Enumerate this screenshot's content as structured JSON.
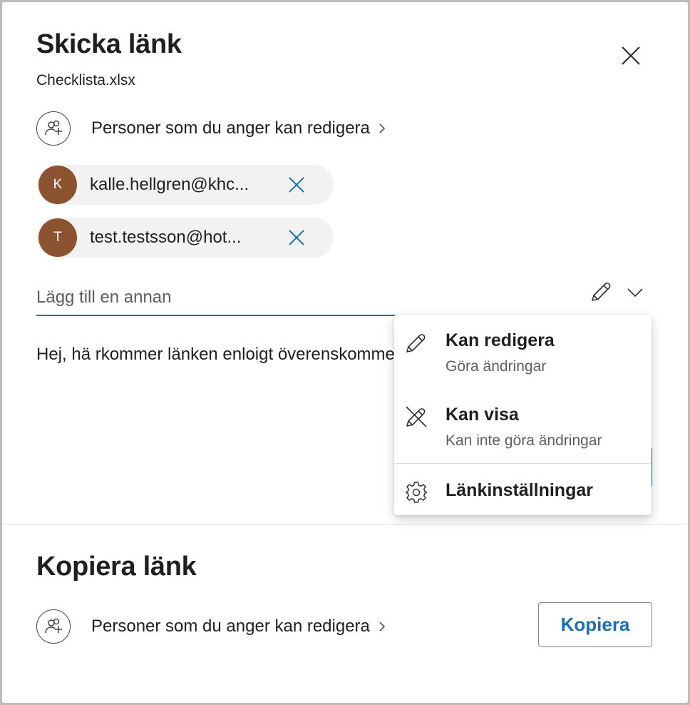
{
  "dialog": {
    "title": "Skicka länk",
    "filename": "Checklista.xlsx",
    "permission_text": "Personer som du anger kan redigera",
    "recipients": [
      {
        "initial": "K",
        "email": "kalle.hellgren@khc..."
      },
      {
        "initial": "T",
        "email": "test.testsson@hot..."
      }
    ],
    "add_placeholder": "Lägg till en annan",
    "message": "Hej, hä rkommer länken enloigt överenskommet"
  },
  "copy_section": {
    "title": "Kopiera länk",
    "permission_text": "Personer som du anger kan redigera",
    "copy_button": "Kopiera"
  },
  "permission_menu": {
    "items": [
      {
        "label": "Kan redigera",
        "sublabel": "Göra ändringar",
        "icon": "pencil-icon"
      },
      {
        "label": "Kan visa",
        "sublabel": "Kan inte göra ändringar",
        "icon": "pencil-off-icon"
      },
      {
        "label": "Länkinställningar",
        "icon": "gear-icon"
      }
    ]
  },
  "colors": {
    "accent": "#1a73b5",
    "avatar": "#8c5331",
    "chip_bg": "#f3f2f1"
  }
}
